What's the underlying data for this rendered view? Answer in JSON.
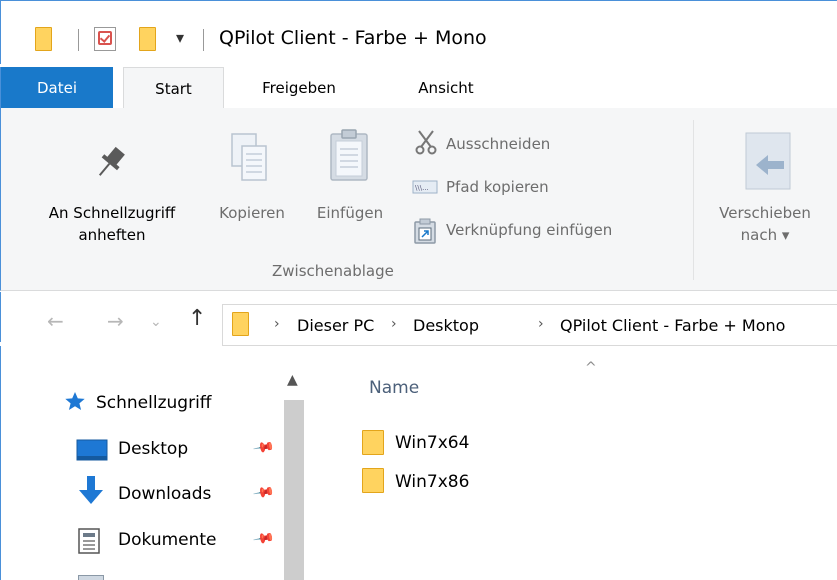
{
  "window": {
    "title": "QPilot Client - Farbe + Mono"
  },
  "quick_access": {
    "dropdown_glyph": "▾"
  },
  "tabs": [
    {
      "label": "Datei",
      "active": false
    },
    {
      "label": "Start",
      "active": true
    },
    {
      "label": "Freigeben",
      "active": false
    },
    {
      "label": "Ansicht",
      "active": false
    }
  ],
  "ribbon": {
    "pin_line1": "An Schnellzugriff",
    "pin_line2": "anheften",
    "copy": "Kopieren",
    "paste": "Einfügen",
    "cut": "Ausschneiden",
    "copy_path": "Pfad kopieren",
    "paste_shortcut": "Verknüpfung einfügen",
    "move_line1": "Verschieben",
    "move_line2": "nach ▾",
    "group_label": "Zwischenablage"
  },
  "address": {
    "crumbs": [
      "Dieser PC",
      "Desktop",
      "QPilot Client - Farbe + Mono"
    ]
  },
  "nav_pane": {
    "quick_access_label": "Schnellzugriff",
    "items": [
      {
        "label": "Desktop",
        "icon": "desktop-icon",
        "pinned": true
      },
      {
        "label": "Downloads",
        "icon": "download-icon",
        "pinned": true
      },
      {
        "label": "Dokumente",
        "icon": "document-icon",
        "pinned": true
      }
    ]
  },
  "content": {
    "column_name": "Name",
    "files": [
      {
        "name": "Win7x64",
        "type": "folder"
      },
      {
        "name": "Win7x86",
        "type": "folder"
      }
    ]
  },
  "colors": {
    "accent": "#1979ca",
    "folder": "#ffd35f",
    "ribbon_bg": "#f5f6f7"
  }
}
